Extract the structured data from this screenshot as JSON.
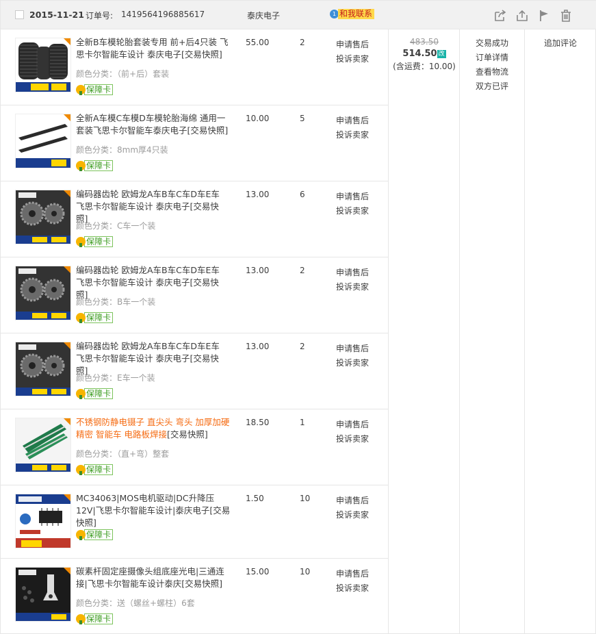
{
  "header": {
    "date": "2015-11-21",
    "order_label": "订单号:",
    "order_number": "1419564196885617",
    "shop_name": "泰庆电子",
    "contact_badge": "1",
    "contact_label": "和我联系",
    "icons": [
      "share-icon",
      "upload-icon",
      "flag-icon",
      "trash-icon"
    ]
  },
  "items": [
    {
      "title": "全新B车模轮胎套装专用 前+后4只装 飞思卡尔智能车设计 泰庆电子[交易快照]",
      "sku_label": "颜色分类：",
      "sku_value": "（前+后）套装",
      "price": "55.00",
      "qty": "2",
      "op1": "申请售后",
      "op2": "投诉卖家",
      "badge": "保障卡",
      "thumb": "tires",
      "highlight": false
    },
    {
      "title": "全新A车模C车模D车模轮胎海绵 通用一套装飞思卡尔智能车泰庆电子[交易快照]",
      "sku_label": "颜色分类：",
      "sku_value": "8mm厚4只装",
      "price": "10.00",
      "qty": "5",
      "op1": "申请售后",
      "op2": "投诉卖家",
      "badge": "保障卡",
      "thumb": "sponge",
      "highlight": false
    },
    {
      "title": "编码器齿轮 欧姆龙A车B车C车D车E车 飞思卡尔智能车设计 泰庆电子[交易快照]",
      "sku_label": "颜色分类：",
      "sku_value": "C车一个装",
      "price": "13.00",
      "qty": "6",
      "op1": "申请售后",
      "op2": "投诉卖家",
      "badge": "保障卡",
      "thumb": "gear",
      "highlight": false
    },
    {
      "title": "编码器齿轮 欧姆龙A车B车C车D车E车 飞思卡尔智能车设计 泰庆电子[交易快照]",
      "sku_label": "颜色分类：",
      "sku_value": "B车一个装",
      "price": "13.00",
      "qty": "2",
      "op1": "申请售后",
      "op2": "投诉卖家",
      "badge": "保障卡",
      "thumb": "gear",
      "highlight": false
    },
    {
      "title": "编码器齿轮 欧姆龙A车B车C车D车E车 飞思卡尔智能车设计 泰庆电子[交易快照]",
      "sku_label": "颜色分类：",
      "sku_value": "E车一个装",
      "price": "13.00",
      "qty": "2",
      "op1": "申请售后",
      "op2": "投诉卖家",
      "badge": "保障卡",
      "thumb": "gear",
      "highlight": false
    },
    {
      "title_hl": "不锈钢防静电镊子 直尖头 弯头 加厚加硬精密 智能车 电路板焊接",
      "title_tail": "[交易快照]",
      "sku_label": "颜色分类：",
      "sku_value": "（直+弯）整套",
      "price": "18.50",
      "qty": "1",
      "op1": "申请售后",
      "op2": "投诉卖家",
      "badge": "保障卡",
      "thumb": "tweezer",
      "highlight": true
    },
    {
      "title": "MC34063|MOS电机驱动|DC升降压12V|飞思卡尔智能车设计|泰庆电子[交易快照]",
      "sku_label": "",
      "sku_value": "",
      "price": "1.50",
      "qty": "10",
      "op1": "申请售后",
      "op2": "投诉卖家",
      "badge": "保障卡",
      "thumb": "chip",
      "highlight": false
    },
    {
      "title": "碳素杆固定座摄像头组底座光电|三通连接|飞思卡尔智能车设计泰庆[交易快照]",
      "sku_label": "颜色分类：",
      "sku_value": "送（螺丝+螺柱）6套",
      "price": "15.00",
      "qty": "10",
      "op1": "申请售后",
      "op2": "投诉卖家",
      "badge": "保障卡",
      "thumb": "mount",
      "highlight": false
    }
  ],
  "total": {
    "original": "483.50",
    "actual": "514.50",
    "modified_tag": "改",
    "shipping": "(含运费：10.00)"
  },
  "status": {
    "line1": "交易成功",
    "line2": "订单详情",
    "line3": "查看物流",
    "line4": "双方已评"
  },
  "review": {
    "label": "追加评论"
  }
}
